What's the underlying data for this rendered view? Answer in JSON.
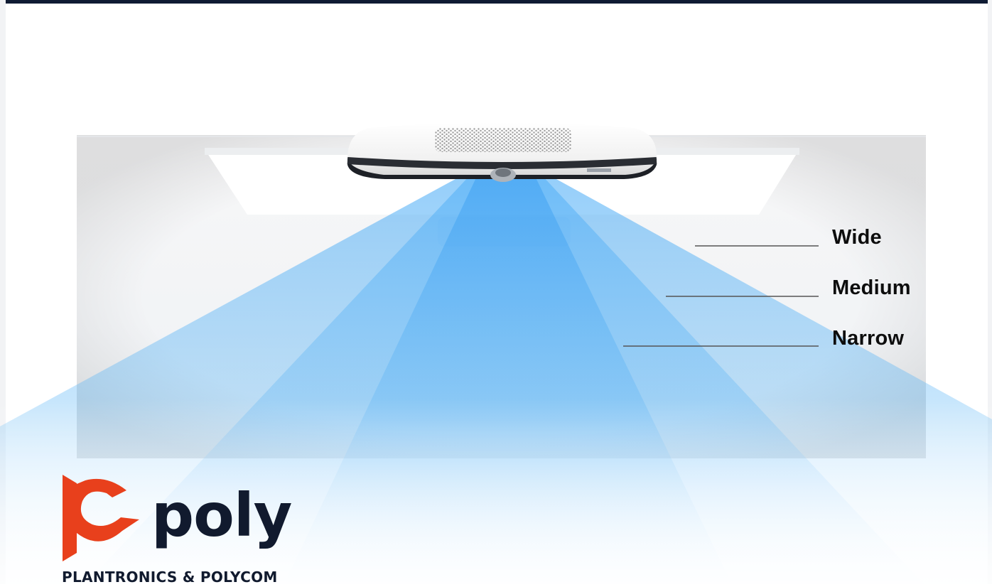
{
  "fov_labels": {
    "wide": "Wide",
    "medium": "Medium",
    "narrow": "Narrow"
  },
  "brand": {
    "wordmark": "poly",
    "tagline": "PLANTRONICS & POLYCOM"
  },
  "colors": {
    "top_bar": "#0f1b33",
    "beam_blue": "#3ea6f5",
    "logo_red": "#e8401c",
    "logo_navy": "#111a2e"
  }
}
